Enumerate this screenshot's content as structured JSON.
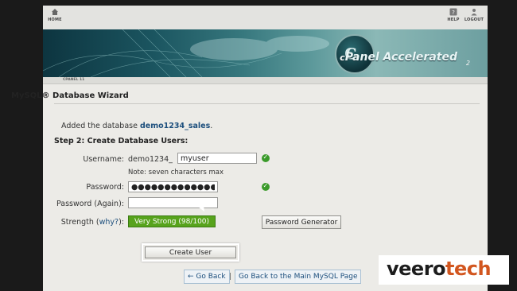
{
  "topbar": {
    "home_label": "HOME",
    "help_label": "HELP",
    "logout_label": "LOGOUT"
  },
  "banner": {
    "logo_letter": "c",
    "brand_c": "c",
    "brand_text": "Panel",
    "brand_accelerated": "Accelerated",
    "brand_sub": "2"
  },
  "subbar": {
    "version_label": "CPANEL 11"
  },
  "page": {
    "title": "MySQL® Database Wizard",
    "added_prefix": "Added the database ",
    "added_db": "demo1234_sales",
    "added_suffix": ".",
    "step_title": "Step 2: Create Database Users:"
  },
  "form": {
    "username_label": "Username:",
    "username_prefix": "demo1234_",
    "username_value": "myuser",
    "note": "Note: seven characters max",
    "password_label": "Password:",
    "password_value": "●●●●●●●●●●●●●",
    "password_again_label": "Password (Again):",
    "password_again_value": "",
    "strength_label": "Strength (",
    "strength_why": "why?",
    "strength_label_end": "):",
    "strength_value": "Very Strong (98/100)",
    "password_generator_label": "Password Generator",
    "create_user_label": "Create User"
  },
  "nav": {
    "go_back": "← Go Back",
    "separator": "|",
    "back_main": "Go Back to the Main MySQL Page"
  },
  "watermark": {
    "part1": "veero",
    "part2": "tech"
  },
  "colors": {
    "strength_green": "#57a31c",
    "link_blue": "#1d4f7d",
    "watermark_orange": "#d2561f"
  }
}
